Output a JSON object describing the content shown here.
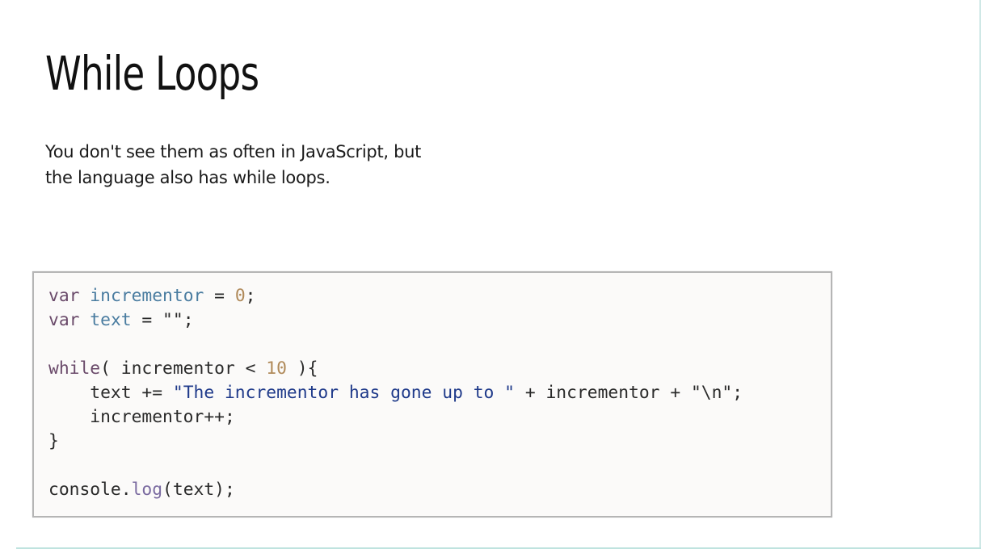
{
  "slide": {
    "title": "While Loops",
    "intro": "You don't see them as often in JavaScript, but the language also has while loops.",
    "intro_lines": [
      "You don't see them as often in JavaScript, but",
      "the language also has while loops."
    ]
  },
  "code": {
    "language": "javascript",
    "colors": {
      "keyword": "#6a4a6a",
      "variable": "#4a7ca0",
      "number": "#b08a5a",
      "string": "#1f3a8a",
      "function": "#7a6aa0",
      "plain": "#2a2a2a"
    },
    "lines": [
      [
        {
          "t": "kw",
          "v": "var"
        },
        {
          "t": "plain",
          "v": " "
        },
        {
          "t": "var",
          "v": "incrementor"
        },
        {
          "t": "plain",
          "v": " = "
        },
        {
          "t": "num",
          "v": "0"
        },
        {
          "t": "plain",
          "v": ";"
        }
      ],
      [
        {
          "t": "kw",
          "v": "var"
        },
        {
          "t": "plain",
          "v": " "
        },
        {
          "t": "var",
          "v": "text"
        },
        {
          "t": "plain",
          "v": " = \"\";"
        }
      ],
      [],
      [
        {
          "t": "kw",
          "v": "while"
        },
        {
          "t": "plain",
          "v": "( incrementor < "
        },
        {
          "t": "num",
          "v": "10"
        },
        {
          "t": "plain",
          "v": " ){"
        }
      ],
      [
        {
          "t": "plain",
          "v": "    text += "
        },
        {
          "t": "str",
          "v": "\"The incrementor has gone up to \""
        },
        {
          "t": "plain",
          "v": " + incrementor + \"\\n\";"
        }
      ],
      [
        {
          "t": "plain",
          "v": "    incrementor++;"
        }
      ],
      [
        {
          "t": "plain",
          "v": "}"
        }
      ],
      [],
      [
        {
          "t": "plain",
          "v": "console."
        },
        {
          "t": "fn",
          "v": "log"
        },
        {
          "t": "plain",
          "v": "(text);"
        }
      ]
    ]
  }
}
